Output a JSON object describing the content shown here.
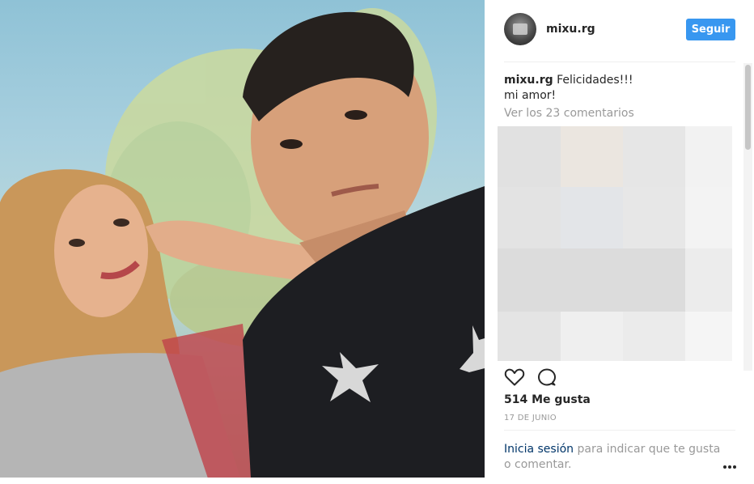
{
  "post": {
    "username": "mixu.rg",
    "follow_label": "Seguir",
    "caption": {
      "user": "mixu.rg",
      "line1": "Felicidades!!!",
      "line2": "mi amor!"
    },
    "view_comments": "Ver los 23 comentarios",
    "likes": "514 Me gusta",
    "date": "17 DE JUNIO",
    "login_link": "Inicia sesión",
    "login_rest": " para indicar que te gusta o comentar."
  },
  "icons": {
    "like": "heart-outline-icon",
    "comment": "speech-bubble-icon",
    "more": "more-options-icon"
  },
  "colors": {
    "accent": "#3897f0",
    "link": "#003569",
    "muted": "#999999",
    "text": "#262626"
  }
}
